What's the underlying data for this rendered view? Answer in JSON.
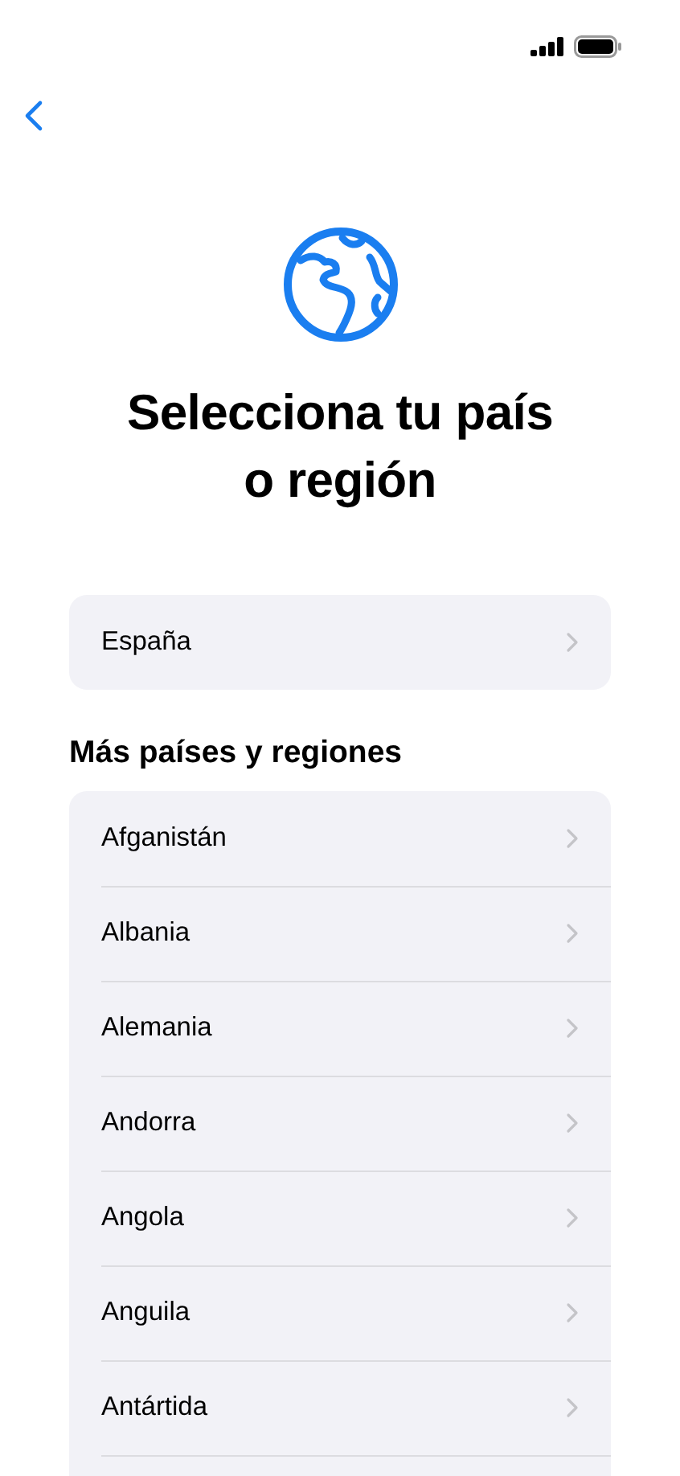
{
  "title_lines": [
    "Selecciona tu país",
    "o región"
  ],
  "current": {
    "label": "España"
  },
  "section_title": "Más países y regiones",
  "countries": [
    {
      "label": "Afganistán"
    },
    {
      "label": "Albania"
    },
    {
      "label": "Alemania"
    },
    {
      "label": "Andorra"
    },
    {
      "label": "Angola"
    },
    {
      "label": "Anguila"
    },
    {
      "label": "Antártida"
    }
  ]
}
